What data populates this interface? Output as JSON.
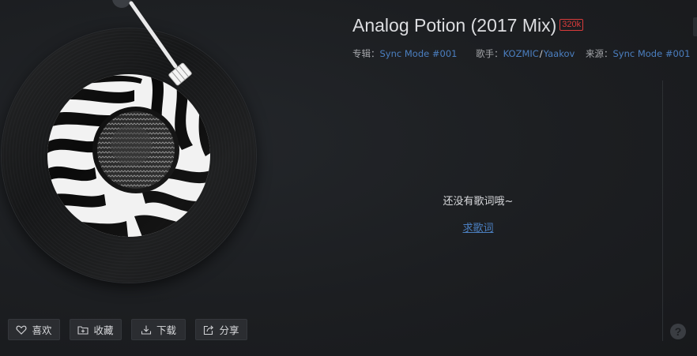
{
  "song": {
    "title": "Analog Potion (2017 Mix)",
    "quality": "320k"
  },
  "meta": {
    "album_label": "专辑：",
    "album": "Sync Mode #001",
    "artist_label": "歌手：",
    "artists": [
      "KOZMIC",
      "Yaakov"
    ],
    "artist_separator": "/",
    "source_label": "来源：",
    "source": "Sync Mode #001"
  },
  "lyrics": {
    "empty_message": "还没有歌词哦~",
    "request_link": "求歌词"
  },
  "actions": {
    "like": "喜欢",
    "collect": "收藏",
    "download": "下载",
    "share": "分享"
  },
  "icons": {
    "like": "heart-icon",
    "collect": "folder-plus-icon",
    "download": "download-icon",
    "share": "share-icon",
    "help": "help-icon"
  },
  "help": {
    "glyph": "?"
  },
  "colors": {
    "background": "#1c1e21",
    "link": "#4b7fc0",
    "quality_badge": "#d93b3b"
  }
}
